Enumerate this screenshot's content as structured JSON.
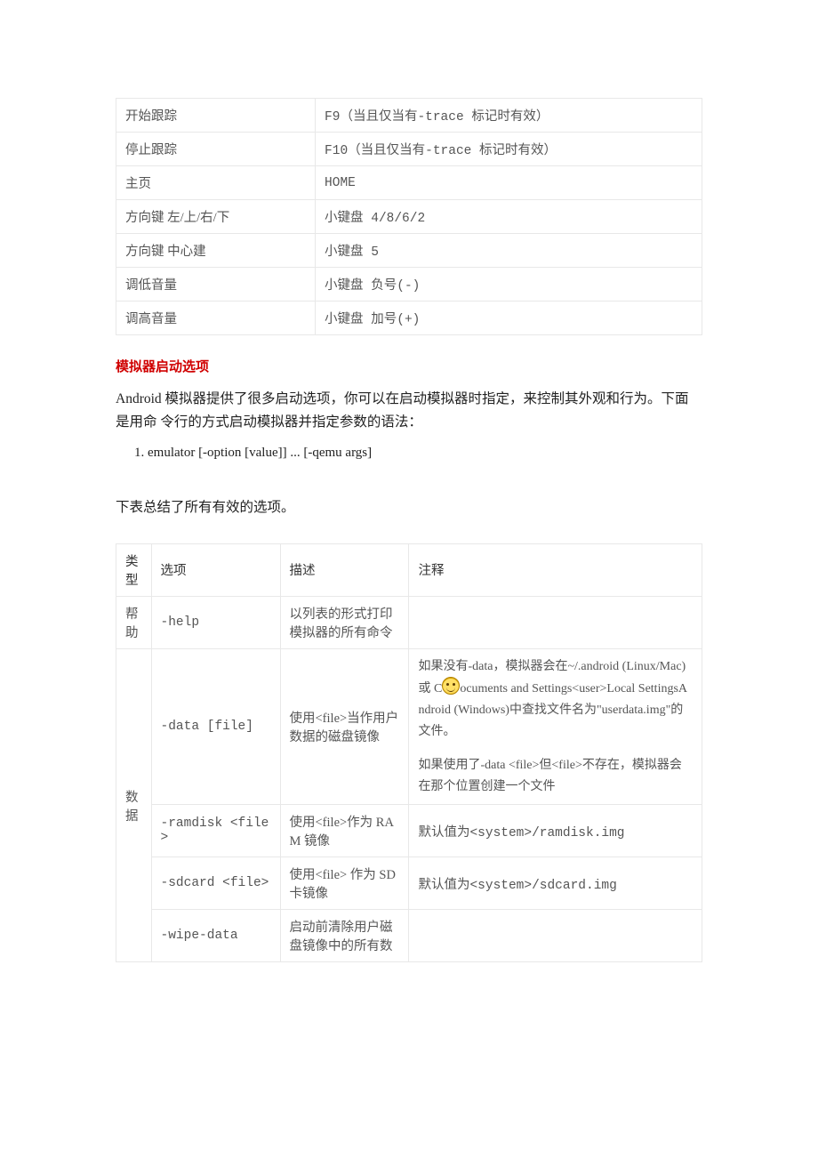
{
  "table1": {
    "rows": [
      {
        "k": "开始跟踪",
        "v": "F9（当且仅当有-trace 标记时有效）"
      },
      {
        "k": "停止跟踪",
        "v": "F10（当且仅当有-trace 标记时有效）"
      },
      {
        "k": "主页",
        "v": "HOME"
      },
      {
        "k": "方向键 左/上/右/下",
        "v": "小键盘 4/8/6/2"
      },
      {
        "k": "方向键 中心建",
        "v": "小键盘 5"
      },
      {
        "k": "调低音量",
        "v": "小键盘 负号(-)"
      },
      {
        "k": "调高音量",
        "v": "小键盘 加号(+)"
      }
    ]
  },
  "heading": "模拟器启动选项",
  "intro1": "Android 模拟器提供了很多启动选项，你可以在启动模拟器时指定，来控制其外观和行为。下面是用命 令行的方式启动模拟器并指定参数的语法：",
  "codeItem": "emulator [-option [value]] ... [-qemu args]",
  "intro2": "下表总结了所有有效的选项。",
  "table2": {
    "header": {
      "c1": "类型",
      "c2": "选项",
      "c3": "描述",
      "c4": "注释"
    },
    "helpRow": {
      "cat": "帮助",
      "opt": "-help",
      "desc": "以列表的形式打印模拟器的所有命令",
      "note": ""
    },
    "dataCat": "数据",
    "dataRows": [
      {
        "opt": "-data [file]",
        "desc": "使用<file>当作用户数据的磁盘镜像",
        "note1a": "如果没有-data，模拟器会在~/.android (Linux/Mac) 或 C",
        "note1b": "ocuments and Settings<user>Local SettingsAndroid (Windows)中查找文件名为\"userdata.img\"的文件。",
        "note2": "如果使用了-data <file>但<file>不存在，模拟器会在那个位置创建一个文件"
      },
      {
        "opt": "-ramdisk <file>",
        "desc": "使用<file>作为 RAM 镜像",
        "note": "默认值为<system>/ramdisk.img"
      },
      {
        "opt": "-sdcard <file>",
        "desc": "使用<file> 作为 SD 卡镜像",
        "note": "默认值为<system>/sdcard.img"
      },
      {
        "opt": "-wipe-data",
        "desc": "启动前清除用户磁盘镜像中的所有数",
        "note": ""
      }
    ]
  }
}
